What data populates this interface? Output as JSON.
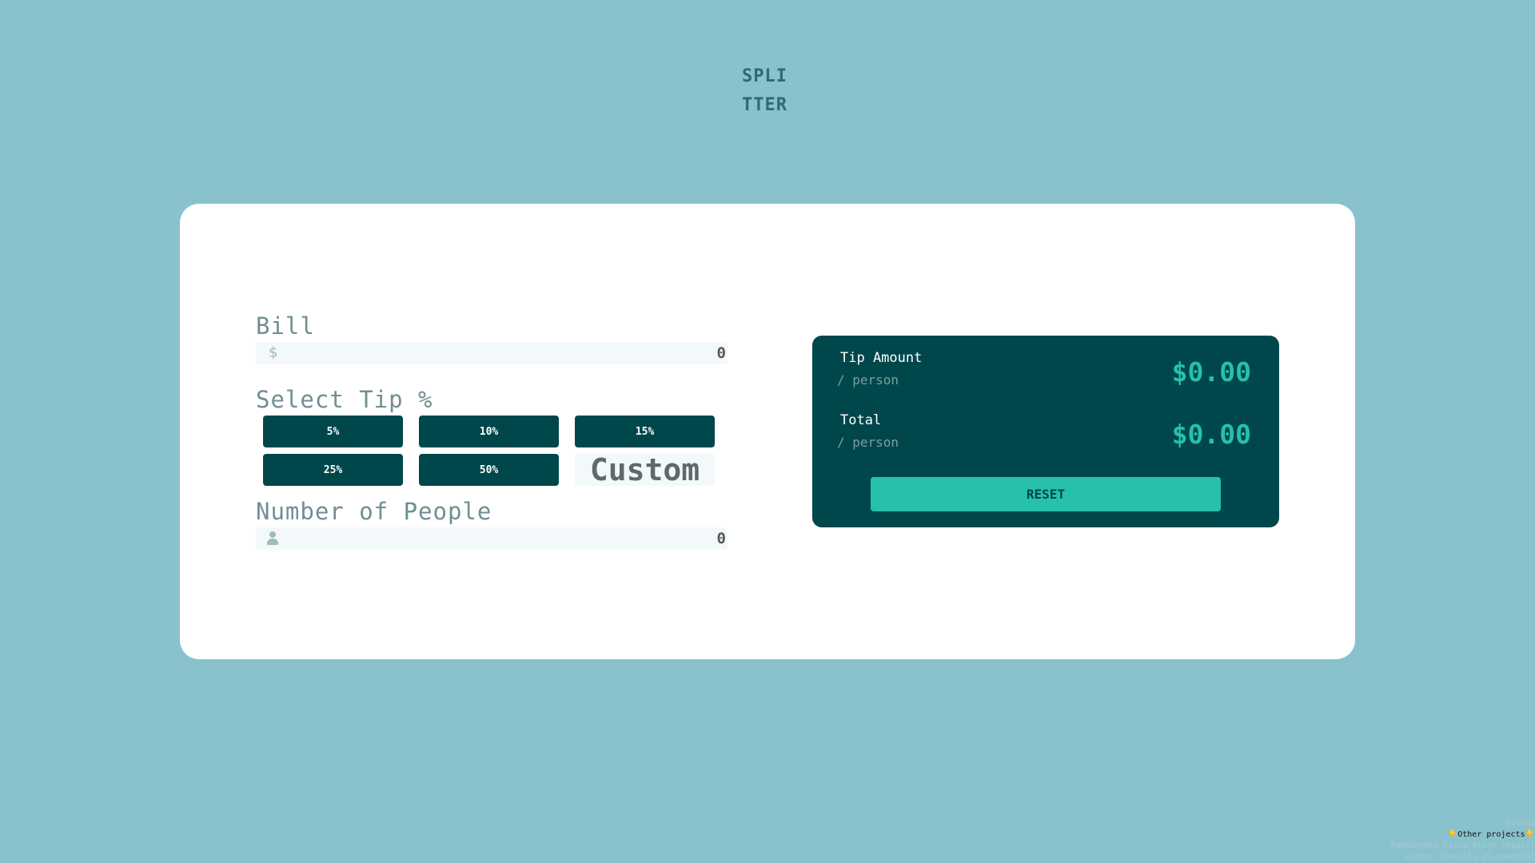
{
  "logo": {
    "line1": "SPLI",
    "line2": "TTER"
  },
  "bill": {
    "label": "Bill",
    "currency_icon": "dollar-icon",
    "prefix": "$",
    "value": "0"
  },
  "tip": {
    "label": "Select Tip %",
    "options": [
      "5%",
      "10%",
      "15%",
      "25%",
      "50%"
    ],
    "custom_label": "Custom"
  },
  "people": {
    "label": "Number of People",
    "icon": "person-icon",
    "value": "0"
  },
  "results": {
    "tip_amount": {
      "title": "Tip Amount",
      "sub": "/ person",
      "value": "$0.00"
    },
    "total": {
      "title": "Total",
      "sub": "/ person",
      "value": "$0.00"
    },
    "reset_label": "RESET"
  },
  "footer": {
    "lines": [
      "GitHub",
      "Other projects",
      "FatWahomes Clone Store (React)",
      "Giphos (Vanilla JS-spanish)"
    ]
  },
  "colors": {
    "background": "#89c2cd",
    "dark": "#00474b",
    "accent": "#26c0ab",
    "card": "#ffffff"
  }
}
